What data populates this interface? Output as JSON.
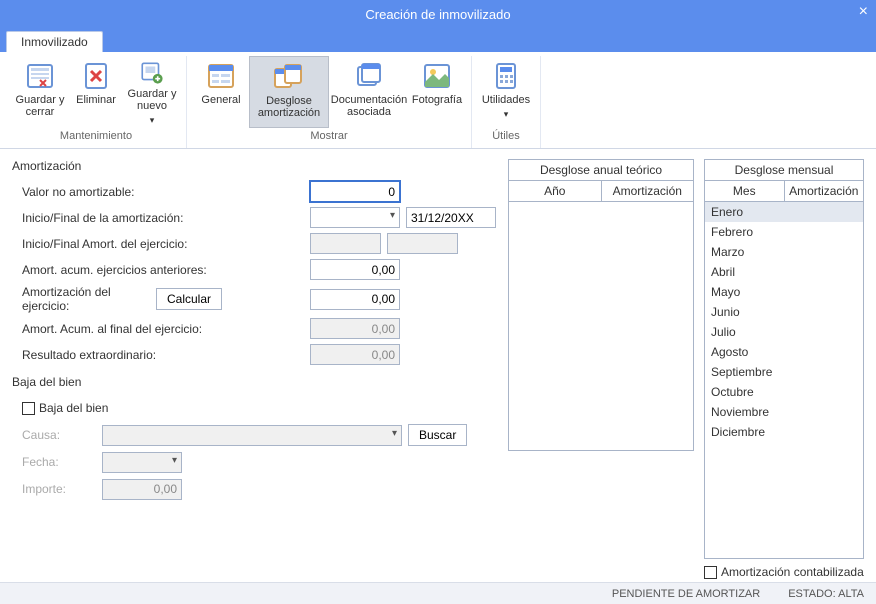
{
  "titlebar": {
    "title": "Creación de inmovilizado"
  },
  "tab": {
    "label": "Inmovilizado"
  },
  "ribbon": {
    "mantenimiento": {
      "label": "Mantenimiento",
      "guardar_cerrar": "Guardar y cerrar",
      "eliminar": "Eliminar",
      "guardar_nuevo": "Guardar y nuevo"
    },
    "mostrar": {
      "label": "Mostrar",
      "general": "General",
      "desglose": "Desglose amortización",
      "documentacion": "Documentación asociada",
      "fotografia": "Fotografía"
    },
    "utiles": {
      "label": "Útiles",
      "utilidades": "Utilidades"
    }
  },
  "form": {
    "section": "Amortización",
    "valor_no_amort_lbl": "Valor no amortizable:",
    "valor_no_amort_val": "0",
    "inicio_final_amort_lbl": "Inicio/Final de la amortización:",
    "inicio_final_amort_end": "31/12/20XX",
    "inicio_final_ejercicio_lbl": "Inicio/Final Amort. del ejercicio:",
    "acum_anteriores_lbl": "Amort. acum. ejercicios anteriores:",
    "acum_anteriores_val": "0,00",
    "amort_ejercicio_lbl": "Amortización del ejercicio:",
    "calcular_btn": "Calcular",
    "amort_ejercicio_val": "0,00",
    "acum_final_lbl": "Amort. Acum. al final del ejercicio:",
    "acum_final_val": "0,00",
    "resultado_lbl": "Resultado extraordinario:",
    "resultado_val": "0,00"
  },
  "baja": {
    "section": "Baja del bien",
    "chk_label": "Baja del bien",
    "causa_lbl": "Causa:",
    "buscar_btn": "Buscar",
    "fecha_lbl": "Fecha:",
    "importe_lbl": "Importe:",
    "importe_val": "0,00"
  },
  "tabla_anual": {
    "title": "Desglose anual teórico",
    "col1": "Año",
    "col2": "Amortización"
  },
  "tabla_mensual": {
    "title": "Desglose mensual",
    "col1": "Mes",
    "col2": "Amortización",
    "rows": [
      "Enero",
      "Febrero",
      "Marzo",
      "Abril",
      "Mayo",
      "Junio",
      "Julio",
      "Agosto",
      "Septiembre",
      "Octubre",
      "Noviembre",
      "Diciembre"
    ]
  },
  "amort_contab_lbl": "Amortización contabilizada",
  "status": {
    "left": "PENDIENTE DE AMORTIZAR",
    "right": "ESTADO: ALTA"
  }
}
